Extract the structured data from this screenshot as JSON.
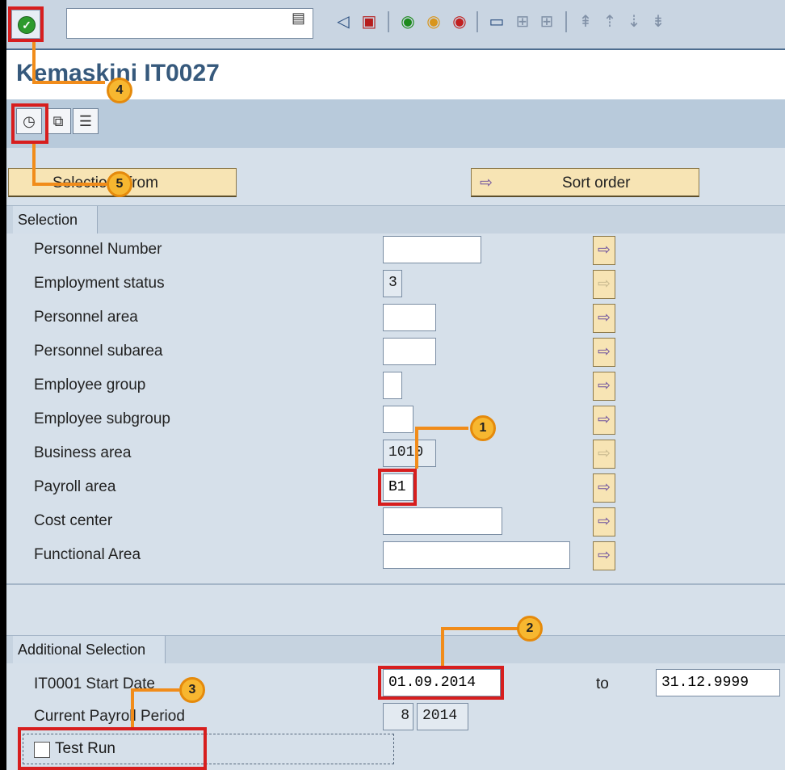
{
  "toolbar": {
    "enter_icon": "check-icon",
    "command_value": "",
    "icons": [
      "back-triangle-icon",
      "save-icon",
      "back-icon",
      "exit-icon",
      "cancel-icon",
      "print-icon",
      "find-icon",
      "find-next-icon",
      "first-page-icon",
      "prev-page-icon",
      "next-page-icon",
      "last-page-icon"
    ]
  },
  "title": "Kemaskini IT0027",
  "app_toolbar": {
    "buttons": [
      "execute-icon",
      "copy-icon",
      "list-icon"
    ]
  },
  "buttons": {
    "selections_from": "Selections from",
    "sort_order": "Sort order"
  },
  "selection": {
    "header": "Selection",
    "fields": [
      {
        "label": "Personnel Number",
        "value": ""
      },
      {
        "label": "Employment status",
        "value": "3"
      },
      {
        "label": "Personnel area",
        "value": ""
      },
      {
        "label": "Personnel subarea",
        "value": ""
      },
      {
        "label": "Employee group",
        "value": ""
      },
      {
        "label": "Employee subgroup",
        "value": ""
      },
      {
        "label": "Business area",
        "value": "1010"
      },
      {
        "label": "Payroll area",
        "value": "B1"
      },
      {
        "label": "Cost center",
        "value": ""
      },
      {
        "label": "Functional Area",
        "value": ""
      }
    ]
  },
  "additional": {
    "header": "Additional Selection",
    "start_date_label": "IT0001 Start Date",
    "start_date_from": "01.09.2014",
    "to_label": "to",
    "start_date_to": "31.12.9999",
    "period_label": "Current Payroll Period",
    "period_num": "8",
    "period_year": "2014",
    "test_run_label": "Test Run",
    "test_run_checked": false
  },
  "callouts": [
    "1",
    "2",
    "3",
    "4",
    "5"
  ]
}
